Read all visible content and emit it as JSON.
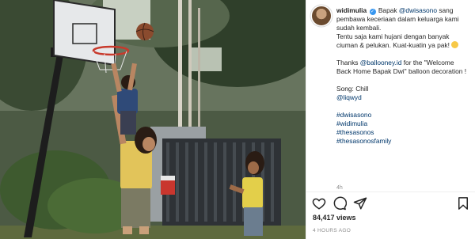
{
  "post": {
    "username": "widimulia",
    "caption": {
      "line1_prefix": "Bapak",
      "mention1": "@dwisasono",
      "line1_suffix": "sang pembawa keceriaan dalam keluarga kami sudah kembali.",
      "line2": "Tentu saja kami hujani dengan banyak ciuman & pelukan. Kuat-kuatin ya pak!",
      "thanks_prefix": "Thanks",
      "mention2": "@ballooney.id",
      "thanks_suffix": "for the \"Welcome Back Home Bapak Dwi\" balloon decoration !",
      "song_label": "Song: Chill",
      "mention3": "@liqwyd",
      "hashtags": [
        "#dwisasono",
        "#widimulia",
        "#thesasonos",
        "#thesasonosfamily"
      ]
    },
    "time_ago": "4h",
    "views": "84,417 views",
    "posted": "4 HOURS AGO"
  },
  "icons": {
    "verified": "verified-badge-icon",
    "emoji": "smiling-face-emoji-icon",
    "like": "heart-icon",
    "comment": "comment-bubble-icon",
    "share": "paper-plane-icon",
    "save": "bookmark-icon"
  },
  "colors": {
    "link": "#00376b",
    "verified": "#3897f0",
    "muted": "#8e8e8e"
  }
}
